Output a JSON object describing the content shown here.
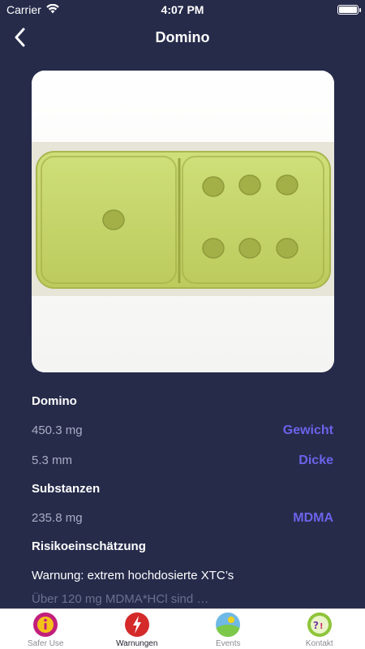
{
  "status_bar": {
    "carrier": "Carrier",
    "time": "4:07 PM"
  },
  "nav": {
    "title": "Domino"
  },
  "pill": {
    "name": "Domino",
    "color": "#c8d96a"
  },
  "details": [
    {
      "value": "450.3 mg",
      "label": "Gewicht"
    },
    {
      "value": "5.3 mm",
      "label": "Dicke"
    }
  ],
  "substances": {
    "heading": "Substanzen",
    "items": [
      {
        "value": "235.8 mg",
        "label": "MDMA"
      }
    ]
  },
  "risk": {
    "heading": "Risikoeinschätzung",
    "text": "Warnung: extrem hochdosierte XTC’s",
    "faded_text": "Über 120 mg MDMA*HCl sind …"
  },
  "tabs": [
    {
      "label": "Safer Use",
      "icon": "info-icon"
    },
    {
      "label": "Warnungen",
      "icon": "warning-icon",
      "active": true
    },
    {
      "label": "Events",
      "icon": "events-icon"
    },
    {
      "label": "Kontakt",
      "icon": "kontakt-icon"
    }
  ]
}
